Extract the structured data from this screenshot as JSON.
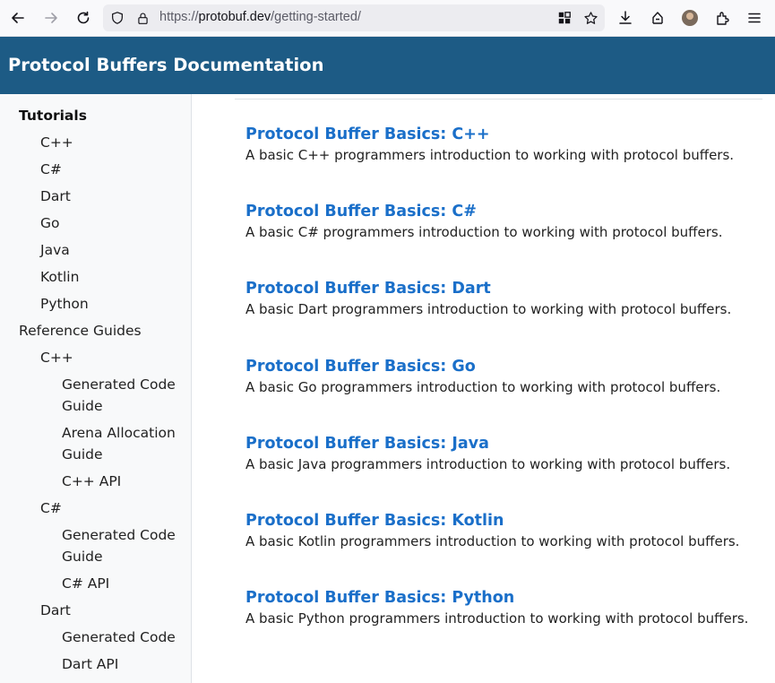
{
  "browser": {
    "url_prefix": "https://",
    "url_host": "protobuf.dev",
    "url_path": "/getting-started/"
  },
  "header": {
    "title": "Protocol Buffers Documentation"
  },
  "sidebar": {
    "tutorials_heading": "Tutorials",
    "tutorials": [
      "C++",
      "C#",
      "Dart",
      "Go",
      "Java",
      "Kotlin",
      "Python"
    ],
    "reference_heading": "Reference Guides",
    "cpp_heading": "C++",
    "cpp_items": [
      "Generated Code",
      "Guide",
      "Arena Allocation",
      "Guide",
      "C++ API"
    ],
    "csharp_heading": "C#",
    "csharp_items": [
      "Generated Code",
      "Guide",
      "C# API"
    ],
    "dart_heading": "Dart",
    "dart_items": [
      "Generated Code",
      "Dart API"
    ]
  },
  "entries": [
    {
      "title": "Protocol Buffer Basics: C++",
      "desc": "A basic C++ programmers introduction to working with protocol buffers."
    },
    {
      "title": "Protocol Buffer Basics: C#",
      "desc": "A basic C# programmers introduction to working with protocol buffers."
    },
    {
      "title": "Protocol Buffer Basics: Dart",
      "desc": "A basic Dart programmers introduction to working with protocol buffers."
    },
    {
      "title": "Protocol Buffer Basics: Go",
      "desc": "A basic Go programmers introduction to working with protocol buffers."
    },
    {
      "title": "Protocol Buffer Basics: Java",
      "desc": "A basic Java programmers introduction to working with protocol buffers."
    },
    {
      "title": "Protocol Buffer Basics: Kotlin",
      "desc": "A basic Kotlin programmers introduction to working with protocol buffers."
    },
    {
      "title": "Protocol Buffer Basics: Python",
      "desc": "A basic Python programmers introduction to working with protocol buffers."
    }
  ],
  "colors": {
    "header_bg": "#1d5b85",
    "link": "#1a6fc9",
    "sidebar_bg": "#f8f9fa"
  }
}
